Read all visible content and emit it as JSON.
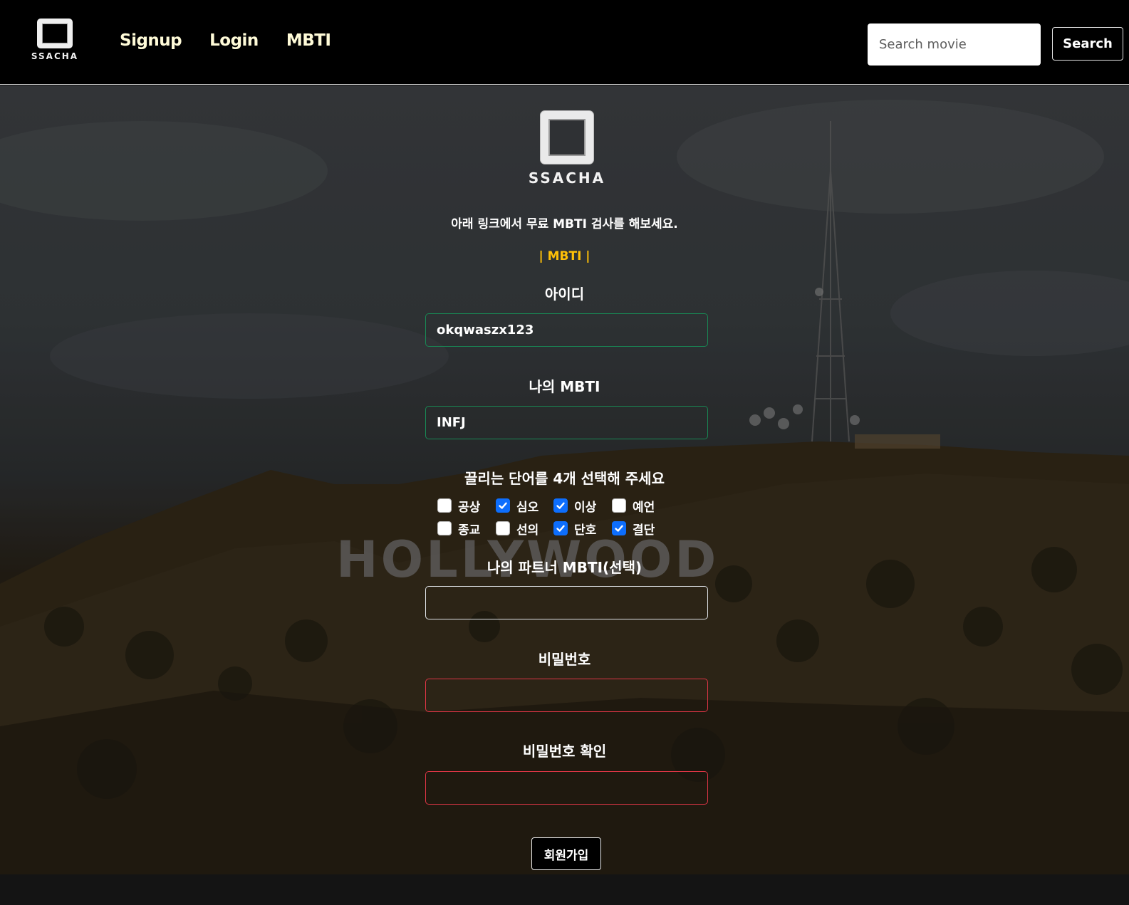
{
  "nav": {
    "brand": "SSACHA",
    "links": [
      "Signup",
      "Login",
      "MBTI"
    ],
    "search_placeholder": "Search movie",
    "search_label": "Search"
  },
  "hero": {
    "sign_text": "HOLLYWOOD"
  },
  "form": {
    "logo_text": "SSACHA",
    "intro": "아래 링크에서 무료 MBTI 검사를 해보세요.",
    "mbti_link": "| MBTI |",
    "id_label": "아이디",
    "id_value": "okqwaszx123",
    "mbti_label": "나의 MBTI",
    "mbti_value": "INFJ",
    "words_label": "끌리는 단어를 4개 선택해 주세요",
    "words": [
      {
        "label": "공상",
        "checked": false
      },
      {
        "label": "심오",
        "checked": true
      },
      {
        "label": "이상",
        "checked": true
      },
      {
        "label": "예언",
        "checked": false
      },
      {
        "label": "종교",
        "checked": false
      },
      {
        "label": "선의",
        "checked": false
      },
      {
        "label": "단호",
        "checked": true
      },
      {
        "label": "결단",
        "checked": true
      }
    ],
    "partner_label": "나의 파트너 MBTI(선택)",
    "partner_value": "",
    "password_label": "비밀번호",
    "password_confirm_label": "비밀번호 확인",
    "submit_label": "회원가입"
  }
}
